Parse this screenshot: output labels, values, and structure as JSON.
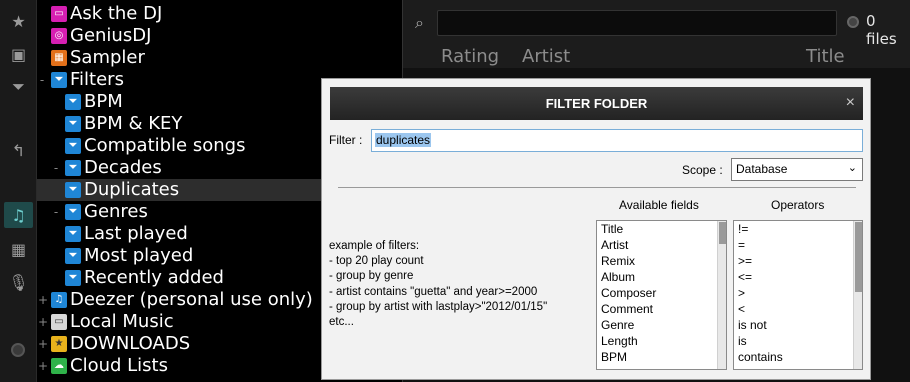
{
  "tree": {
    "items": [
      {
        "label": "Ask the DJ",
        "icon": "ask-dj-icon"
      },
      {
        "label": "GeniusDJ",
        "icon": "geniusdj-icon"
      },
      {
        "label": "Sampler",
        "icon": "sampler-icon"
      },
      {
        "label": "Filters",
        "icon": "filter-folder-icon"
      },
      {
        "label": "BPM",
        "icon": "filter-icon"
      },
      {
        "label": "BPM & KEY",
        "icon": "filter-icon"
      },
      {
        "label": "Compatible songs",
        "icon": "filter-icon"
      },
      {
        "label": "Decades",
        "icon": "filter-icon"
      },
      {
        "label": "Duplicates",
        "icon": "filter-icon"
      },
      {
        "label": "Genres",
        "icon": "filter-icon"
      },
      {
        "label": "Last played",
        "icon": "filter-icon"
      },
      {
        "label": "Most played",
        "icon": "filter-icon"
      },
      {
        "label": "Recently added",
        "icon": "filter-icon"
      },
      {
        "label": "Deezer (personal use only)",
        "icon": "deezer-icon"
      },
      {
        "label": "Local Music",
        "icon": "computer-icon"
      },
      {
        "label": "DOWNLOADS",
        "icon": "star-folder-icon"
      },
      {
        "label": "Cloud Lists",
        "icon": "cloud-icon"
      }
    ],
    "selected": "Duplicates"
  },
  "browser": {
    "files_count": "0 files",
    "columns": [
      "Rating",
      "Artist",
      "Title"
    ]
  },
  "dialog": {
    "title": "FILTER FOLDER",
    "close": "×",
    "filter_label": "Filter :",
    "filter_value": "duplicates",
    "scope_label": "Scope :",
    "scope_value": "Database",
    "examples_title": "example of filters:",
    "examples": [
      "- top 20 play count",
      "- group by genre",
      "- artist contains \"guetta\" and year>=2000",
      "- group by artist with lastplay>\"2012/01/15\"",
      "etc..."
    ],
    "available_fields_label": "Available fields",
    "available_fields": [
      "Title",
      "Artist",
      "Remix",
      "Album",
      "Composer",
      "Comment",
      "Genre",
      "Length",
      "BPM"
    ],
    "operators_label": "Operators",
    "operators": [
      "!=",
      "=",
      ">=",
      "<=",
      ">",
      "<",
      "is not",
      "is",
      "contains"
    ]
  },
  "colors": {
    "selected_row": "#2d2d2d",
    "filter_icon": "#1f86d6",
    "dialog_bg": "#f2f2f2",
    "selection_highlight": "#9bc6ee"
  }
}
